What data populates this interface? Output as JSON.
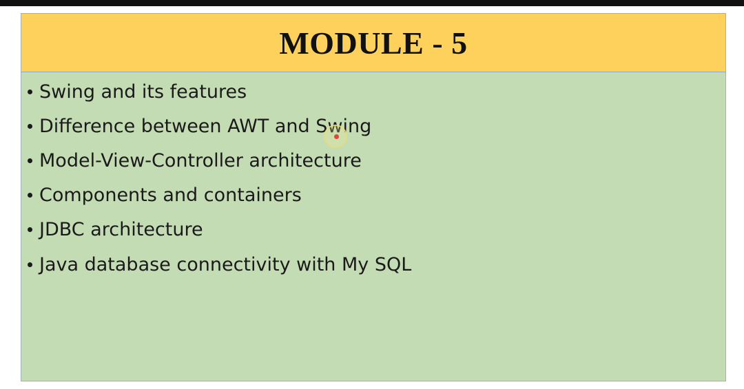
{
  "slide": {
    "title": "MODULE - 5",
    "bullets": [
      "Swing and its features",
      "Difference between AWT and Swing",
      "Model-View-Controller architecture",
      "Components and containers",
      "JDBC architecture",
      "Java database connectivity with My SQL"
    ]
  },
  "colors": {
    "title_band": "#fdd15c",
    "content_background": "#c4dcb4",
    "top_bar": "#111111",
    "cursor_dot": "#e2473a"
  },
  "icons": {
    "bullet": "bullet-dot-icon",
    "pointer": "pointer-highlight-icon"
  }
}
